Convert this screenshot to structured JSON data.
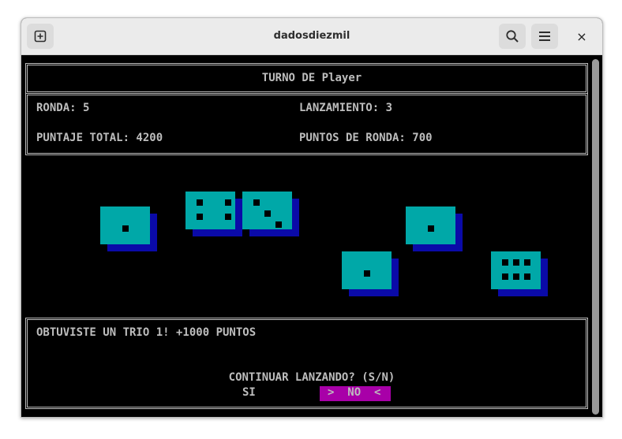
{
  "window": {
    "title": "dadosdiezmil"
  },
  "icons": {
    "new_tab": "new-tab-icon",
    "search": "search-icon",
    "menu": "hamburger-menu-icon",
    "close": "close-icon"
  },
  "close_glyph": "×",
  "header": {
    "turn": "TURNO DE Player"
  },
  "stats": {
    "ronda": "RONDA: 5",
    "lanzamiento": "LANZAMIENTO: 3",
    "puntaje_total": "PUNTAJE TOTAL: 4200",
    "puntos_ronda": "PUNTOS DE RONDA: 700"
  },
  "dice": [
    1,
    4,
    3,
    1,
    1,
    6
  ],
  "message": {
    "result": "OBTUVISTE UN TRIO 1! +1000 PUNTOS",
    "prompt": "CONTINUAR LANZANDO? (S/N)"
  },
  "options": {
    "yes": "SI",
    "no": ">  NO  <",
    "selected": "NO"
  },
  "colors": {
    "die_face": "#00a8a8",
    "die_shadow": "#0a0aa8",
    "selection": "#a800a8",
    "text": "#bdbdbd"
  }
}
